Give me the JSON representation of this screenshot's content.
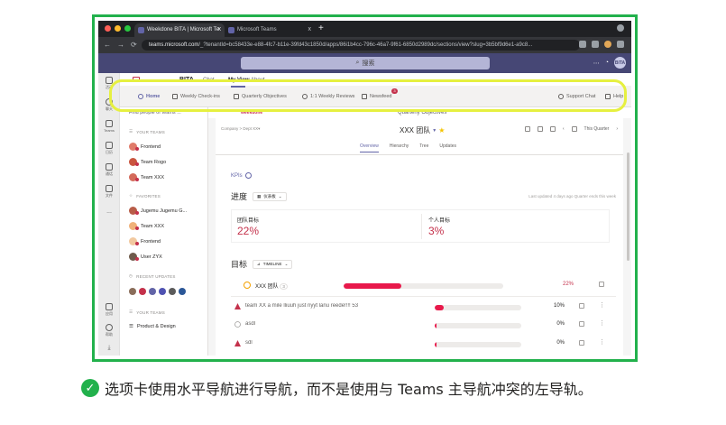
{
  "browser": {
    "tabs": [
      {
        "label": "Weekdone BITA | Microsoft Te",
        "close": "x"
      },
      {
        "label": "Microsoft Teams",
        "close": "x"
      }
    ],
    "new_tab": "+",
    "url_host": "teams.microsoft.com",
    "url_path": "/_?tenantId=bc58433e-e88-4fc7-b11e-39fd43c1850d/apps/86i1b4cc-796c-46a7-9f61-6850d2989dc/sections/view?slug=3b5bf9d6e1-a9c8..."
  },
  "teams": {
    "search_placeholder": "搜索",
    "me_initials": "BITA",
    "rail": [
      {
        "label": "活动"
      },
      {
        "label": "聊天"
      },
      {
        "label": "Teams"
      },
      {
        "label": "日历"
      },
      {
        "label": "通话"
      },
      {
        "label": "文件"
      },
      {
        "label": "..."
      },
      {
        "label": "应用"
      },
      {
        "label": "帮助"
      }
    ]
  },
  "app": {
    "name": "BITA",
    "header_tabs": [
      "Chat",
      "My View",
      "About"
    ],
    "nav_tabs": [
      {
        "label": "Home",
        "active": true
      },
      {
        "label": "Weekly Check-ins"
      },
      {
        "label": "Quarterly Objectives"
      },
      {
        "label": "1:1 Weekly Reviews"
      },
      {
        "label": "Newsfeed"
      }
    ],
    "newsfeed_badge": "3",
    "support": "Support Chat",
    "help": "Help",
    "side": {
      "search": "Find people or teams ...",
      "your_teams_label": "YOUR TEAMS",
      "teams": [
        "Frontend",
        "Team Rogo",
        "Team XXX"
      ],
      "favorites_label": "FAVORITES",
      "favorites": [
        "Jugemu Jugemu G...",
        "Team XXX",
        "Frontend",
        "User ZYX"
      ],
      "recent_label": "RECENT UPDATES",
      "your_teams2_label": "YOUR TEAMS",
      "product": "Product & Design"
    },
    "main": {
      "brand": "weekdone",
      "page_label": "Quarterly Objectives",
      "crumb": "Company > Dept XX▾",
      "team_title": "XXX 团队",
      "quarter": "This Quarter",
      "subtabs": [
        "Overview",
        "Hierarchy",
        "Tree",
        "Updates"
      ],
      "kpis": "KPIs",
      "progress_title": "进度",
      "progress_pill": "仪表板",
      "updated": "Last updated 4 days ago  Quarter ends this week",
      "team_goal_label": "团队目标",
      "team_goal_value": "22%",
      "personal_goal_label": "个人目标",
      "personal_goal_value": "3%",
      "goals_title": "目标",
      "timeline_pill": "TIMELINE",
      "team_row": {
        "label": "XXX 团队",
        "count": "3",
        "pct": "22%",
        "progress": 0.36
      },
      "rows": [
        {
          "label": "team XX a mile lliuuh just nyyt lanu reede!!!! 53",
          "pct": "10%",
          "progress": 0.1
        },
        {
          "label": "asdl",
          "pct": "0%",
          "progress": 0.02
        },
        {
          "label": "sdl",
          "pct": "0%",
          "progress": 0.02
        }
      ]
    }
  },
  "caption": "选项卡使用水平导航进行导航，而不是使用与 Teams 主导航冲突的左导轨。",
  "colors": {
    "frame": "#22b14c",
    "highlight": "#e6f040",
    "teams_purple": "#464775",
    "accent": "#6264a7",
    "progress": "#e8194b",
    "pct_text": "#c4314b"
  }
}
